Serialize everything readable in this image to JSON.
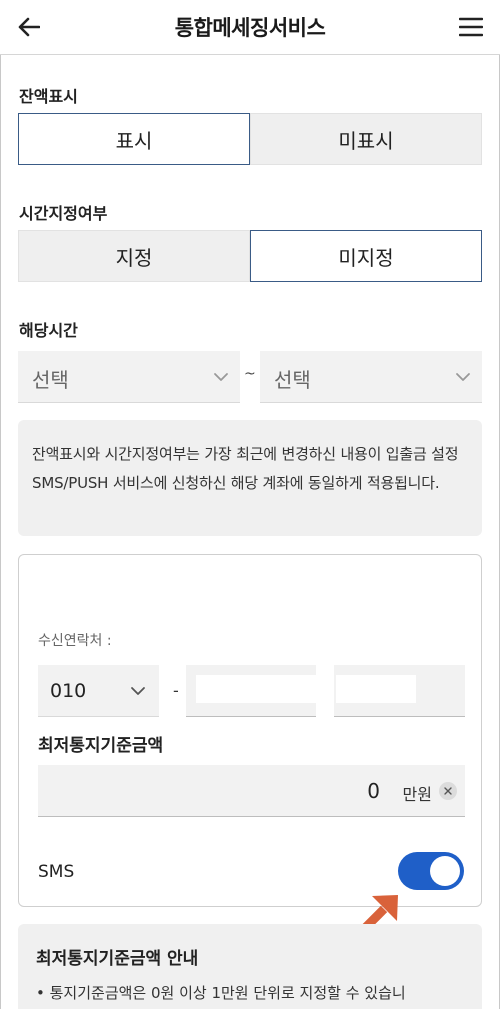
{
  "header": {
    "title": "통합메세징서비스",
    "back_icon": "arrow-left-icon",
    "menu_icon": "hamburger-menu-icon"
  },
  "balance_display": {
    "label": "잔액표시",
    "options": [
      "표시",
      "미표시"
    ],
    "selected": "표시"
  },
  "time_setting": {
    "label": "시간지정여부",
    "options": [
      "지정",
      "미지정"
    ],
    "selected": "미지정"
  },
  "time_range": {
    "label": "해당시간",
    "start_value": "선택",
    "separator": "~",
    "end_value": "선택"
  },
  "info_text": "잔액표시와 시간지정여부는 가장 최근에 변경하신 내용이 입출금 설정 SMS/PUSH 서비스에 신청하신 해당 계좌에 동일하게 적용됩니다.",
  "card": {
    "contact_label": "수신연락처 :",
    "phone_prefix": "010",
    "phone_separator": "-",
    "min_amount_label": "최저통지기준금액",
    "amount_value": "0",
    "amount_unit": "만원",
    "sms_label": "SMS",
    "sms_enabled": true
  },
  "notice": {
    "title": "최저통지기준금액 안내",
    "bullet": "• 통지기준금액은 0원 이상 1만원 단위로 지정할 수 있습니"
  },
  "colors": {
    "accent_border": "#3a5b86",
    "toggle_on": "#1f5fc8",
    "pointer_arrow": "#d9623a"
  }
}
